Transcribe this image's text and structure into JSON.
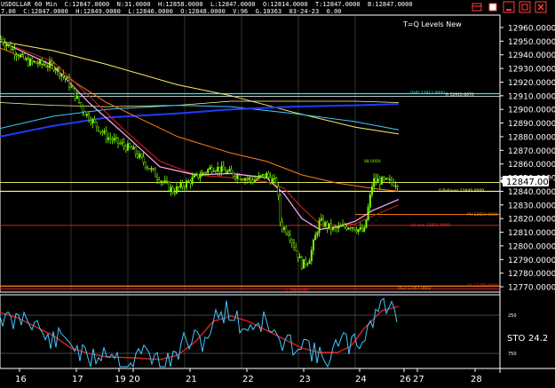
{
  "window": {
    "title_line1": "USDOLLAR 60 Min  C:12847.0000  N:31.0000  H:12858.0000  L:12847.0000  O:12814.0000  T:12847.0000  B:12847.0000",
    "title_line2": "7.00  C:12847.0000  H:12849.0000  L:12846.0000  O:12848.0000  V:96  G.10363  03-24-23  0.00"
  },
  "chart": {
    "label": "T=Q Levels New",
    "last_price": "12847.0000",
    "price_axis": [
      "12960.0000",
      "12950.0000",
      "12940.0000",
      "12930.0000",
      "12920.0000",
      "12910.0000",
      "12900.0000",
      "12890.0000",
      "12880.0000",
      "12870.0000",
      "12860.0000",
      "12850.0000",
      "12840.0000",
      "12830.0000",
      "12820.0000",
      "12810.0000",
      "12800.0000",
      "12790.0000",
      "12780.0000",
      "12770.0000"
    ],
    "date_axis": [
      "16",
      "17",
      "19",
      "20",
      "21",
      "22",
      "23",
      "24",
      "26",
      "27",
      "28"
    ],
    "levels": [
      {
        "text": "OHD 12912.0000",
        "color": "#39e6e6"
      },
      {
        "text": "R 12910.6670",
        "color": "#ffffff"
      },
      {
        "text": "88.0000",
        "color": "#7CFC00"
      },
      {
        "text": "0 Rollover 12840.0000",
        "color": "#ffff66"
      },
      {
        "text": "PH 12823.0000",
        "color": "#ff8c1a"
      },
      {
        "text": "LH Low 12815.0000",
        "color": "#ff3030"
      },
      {
        "text": "OL3 12767.0602",
        "color": "#ff8c1a"
      },
      {
        "text": "OL 12770.0000",
        "color": "#ff3030"
      },
      {
        "text": "L 796.0000",
        "color": "#ff3030"
      }
    ]
  },
  "oscillator": {
    "label": "STO",
    "value": "24.2",
    "levels": [
      "250",
      "750"
    ]
  },
  "colors": {
    "candle_up": "#7CFC00",
    "ma_blue": "#1e3cff",
    "ma_cyan": "#40c8ff",
    "ma_yellow": "#ffee66",
    "ma_orange": "#ff7a1a",
    "ma_red": "#e02020",
    "ma_pink": "#ffb0ff",
    "level_cyan": "#39e6e6",
    "level_yellow": "#ffff66",
    "level_orange": "#ff8c1a",
    "level_red": "#ff3030",
    "sto_line": "#40c8ff",
    "sto_signal": "#e02020"
  },
  "icons": [
    "restore-icon",
    "minimize-icon",
    "maximize-icon",
    "close-icon",
    "settings-icon"
  ]
}
